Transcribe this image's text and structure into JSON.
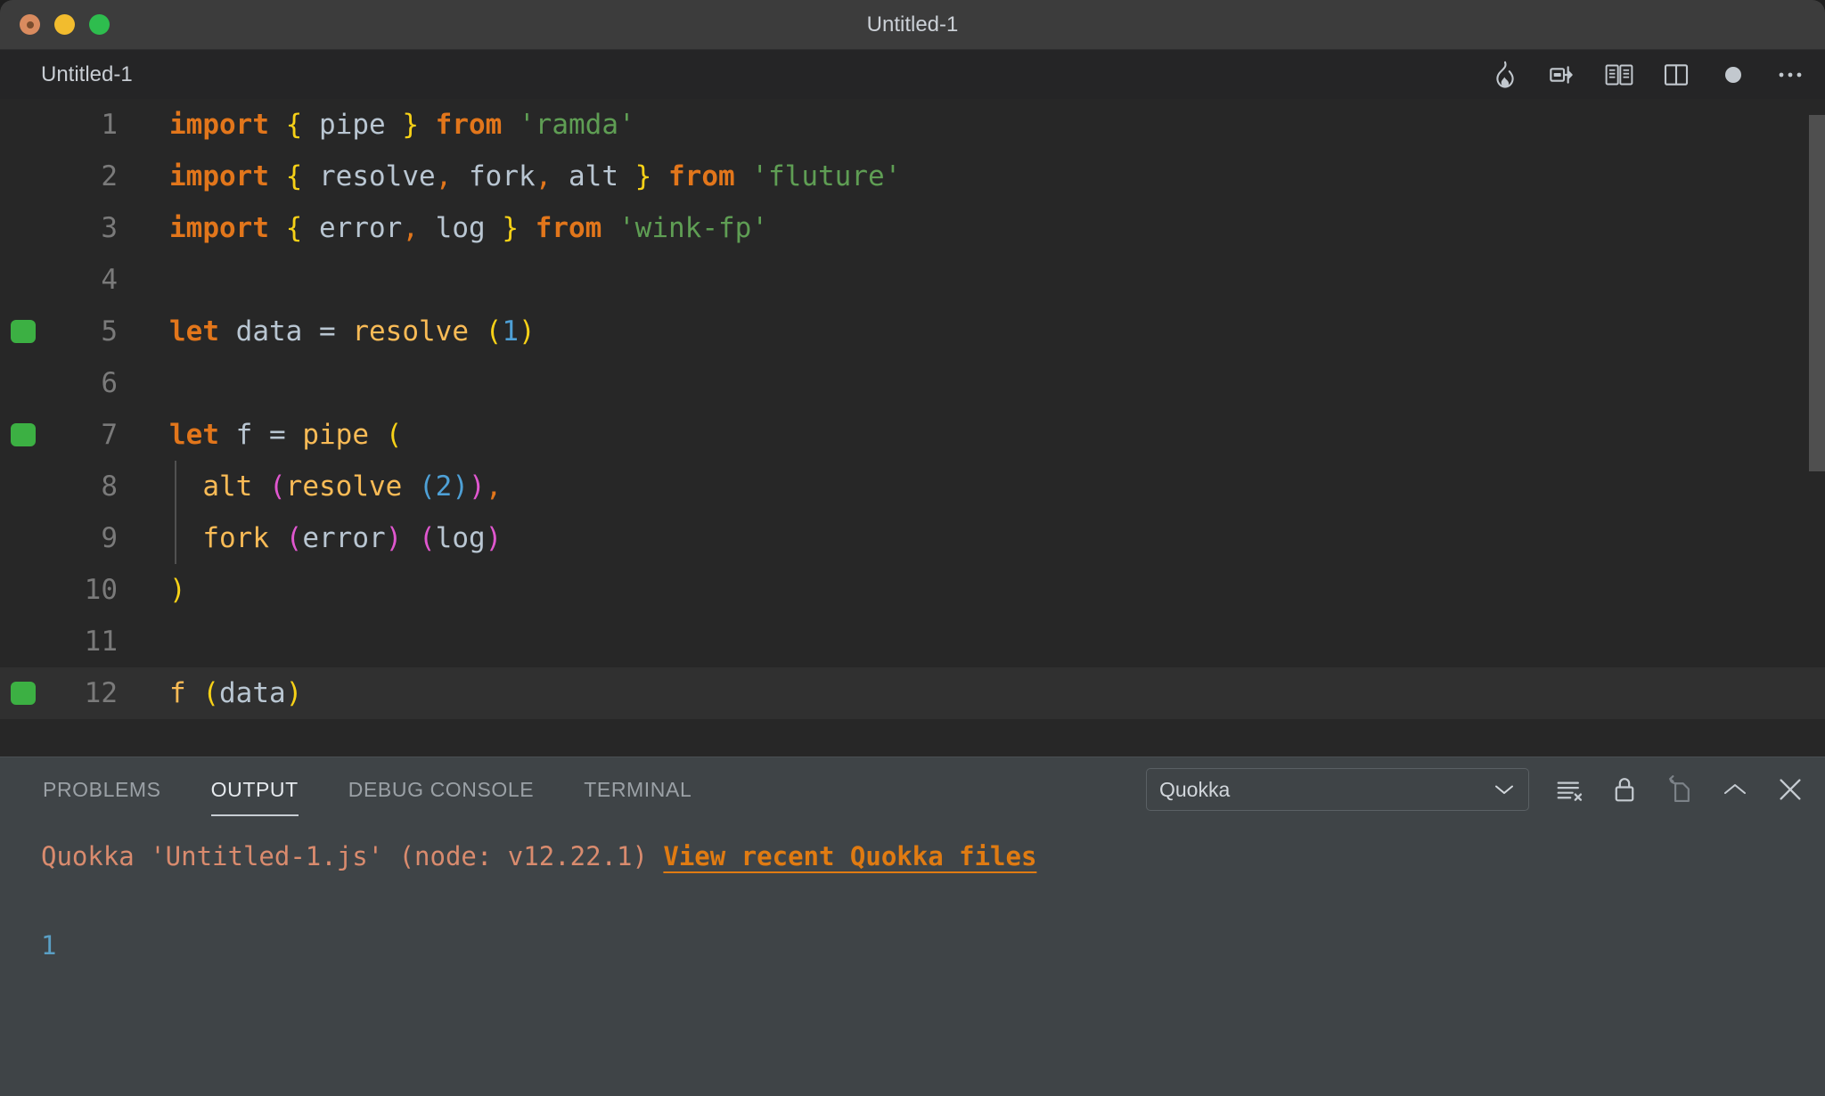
{
  "window": {
    "title": "Untitled-1",
    "traffic_lights": [
      "close-button",
      "minimize-button",
      "maximize-button"
    ]
  },
  "editor": {
    "tab_label": "Untitled-1",
    "actions": [
      {
        "name": "quokka-flame-icon",
        "label": "Quokka"
      },
      {
        "name": "split-editor-right-icon",
        "label": "Split Editor Right"
      },
      {
        "name": "open-preview-icon",
        "label": "Open Preview"
      },
      {
        "name": "split-editor-icon",
        "label": "Split Editor"
      },
      {
        "name": "unsaved-dot-icon",
        "label": "Unsaved changes"
      },
      {
        "name": "more-actions-icon",
        "label": "More Actions..."
      }
    ],
    "lines": [
      {
        "n": "1",
        "mark": false,
        "indent": 0
      },
      {
        "n": "2",
        "mark": false,
        "indent": 0
      },
      {
        "n": "3",
        "mark": false,
        "indent": 0
      },
      {
        "n": "4",
        "mark": false,
        "indent": 0
      },
      {
        "n": "5",
        "mark": true,
        "indent": 0
      },
      {
        "n": "6",
        "mark": false,
        "indent": 0
      },
      {
        "n": "7",
        "mark": true,
        "indent": 0
      },
      {
        "n": "8",
        "mark": false,
        "indent": 1
      },
      {
        "n": "9",
        "mark": false,
        "indent": 1
      },
      {
        "n": "10",
        "mark": false,
        "indent": 0
      },
      {
        "n": "11",
        "mark": false,
        "indent": 0
      },
      {
        "n": "12",
        "mark": true,
        "indent": 0,
        "current": true
      }
    ],
    "source": [
      "import { pipe } from 'ramda'",
      "import { resolve, fork, alt } from 'fluture'",
      "import { error, log } from 'wink-fp'",
      "",
      "let data = resolve (1)",
      "",
      "let f = pipe (",
      "  alt (resolve (2)),",
      "  fork (error) (log)",
      ")",
      "",
      "f (data)"
    ],
    "language": "javascript"
  },
  "panel": {
    "tabs": [
      {
        "label": "PROBLEMS",
        "active": false
      },
      {
        "label": "OUTPUT",
        "active": true
      },
      {
        "label": "DEBUG CONSOLE",
        "active": false
      },
      {
        "label": "TERMINAL",
        "active": false
      }
    ],
    "channel_select": {
      "value": "Quokka",
      "options": [
        "Quokka"
      ]
    },
    "actions": [
      {
        "name": "clear-output-icon",
        "label": "Clear Output"
      },
      {
        "name": "lock-scroll-icon",
        "label": "Turn Auto Scrolling Off"
      },
      {
        "name": "open-in-editor-icon",
        "label": "Open Output in Editor",
        "disabled": true
      },
      {
        "name": "maximize-panel-icon",
        "label": "Maximize Panel Size"
      },
      {
        "name": "close-panel-icon",
        "label": "Close Panel"
      }
    ],
    "output": {
      "header_prefix": "Quokka 'Untitled-1.js' (node: v12.22.1) ",
      "header_link": "View recent Quokka files",
      "value": "1"
    }
  },
  "colors": {
    "titlebar_bg": "#3c3c3c",
    "editor_bg": "#272727",
    "panel_bg": "#3f4447",
    "keyword": "#e2761b",
    "string": "#5f9e54",
    "function": "#f9bb56",
    "number": "#4ea0d6",
    "identifier": "#b9c6d2",
    "bracket_level_1": "#f7d117",
    "bracket_level_2": "#e057cf",
    "bracket_level_3": "#4ea0d6",
    "gutter_mark": "#3cb043",
    "output_text": "#d98b6e",
    "output_link": "#e07b12",
    "output_value": "#5a9fc4",
    "traffic_close": "#d98b5f",
    "traffic_min": "#f2bc2e",
    "traffic_max": "#2ebd4e"
  }
}
